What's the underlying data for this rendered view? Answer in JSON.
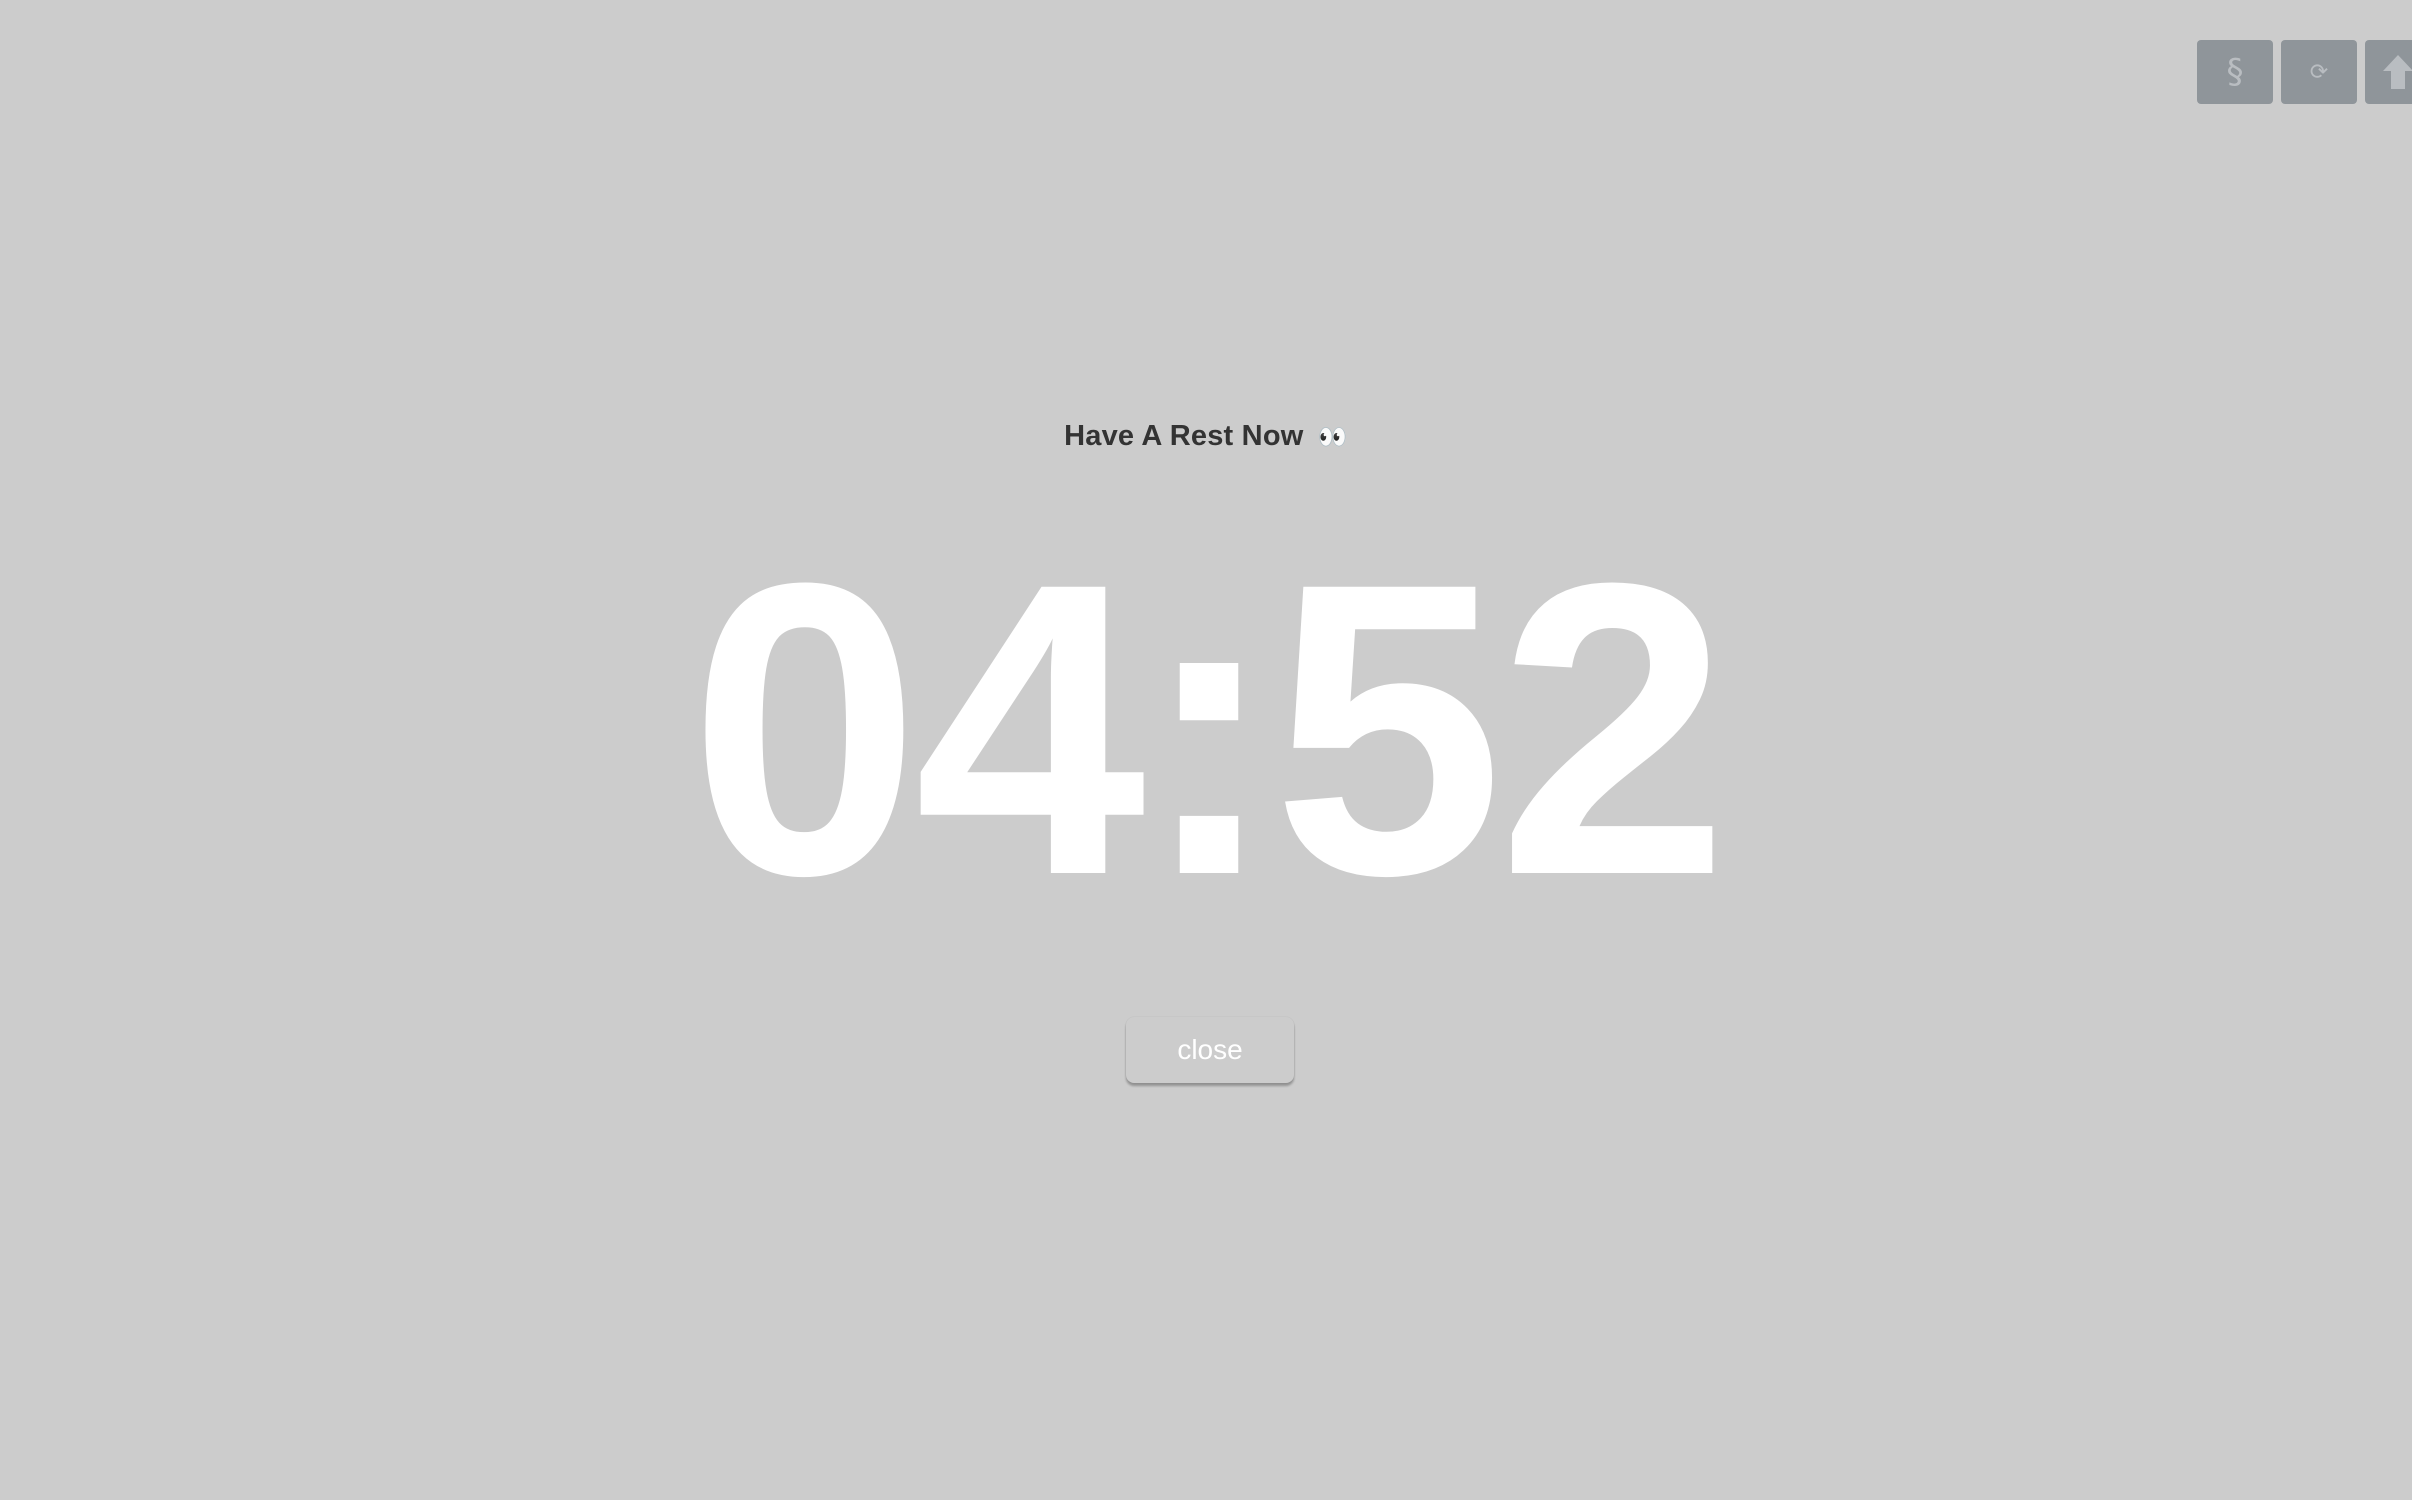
{
  "toolbar": {
    "buttons": [
      {
        "icon": "section-sign-icon",
        "glyph": "§"
      },
      {
        "icon": "refresh-icon",
        "glyph": "⟳"
      },
      {
        "icon": "arrow-up-icon",
        "glyph": ""
      }
    ]
  },
  "rest_screen": {
    "title": "Have A Rest Now",
    "title_emoji": "👀",
    "countdown": "04:52",
    "close_label": "close"
  },
  "colors": {
    "background": "#cccccc",
    "timer_text": "#ffffff",
    "title_text": "#333333",
    "toolbar_button": "#8f959a"
  }
}
